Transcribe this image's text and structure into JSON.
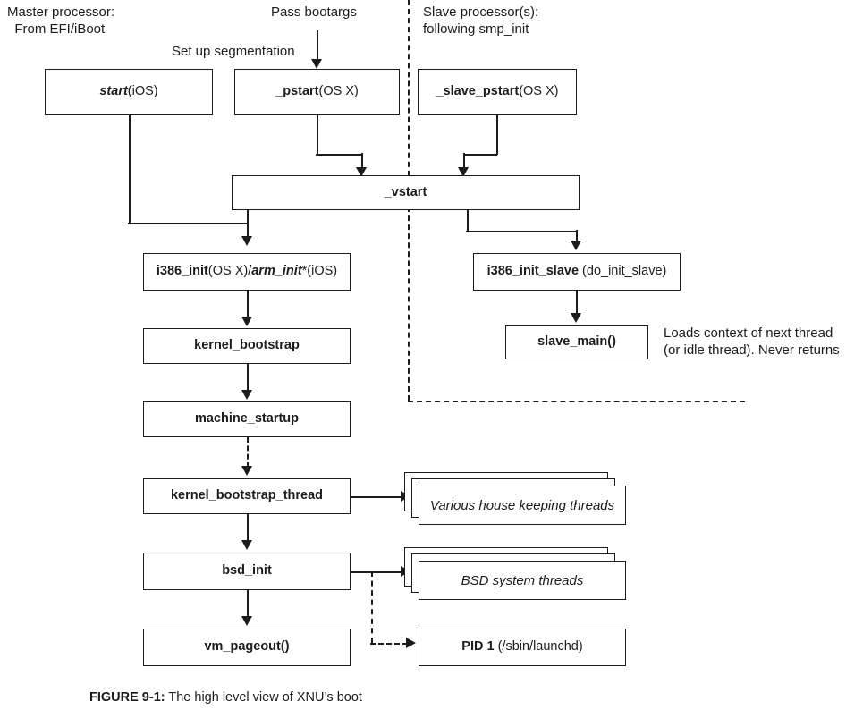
{
  "figure": {
    "caption_number": "FIGURE 9-1:",
    "caption_text": "The high level view of XNU’s boot"
  },
  "annotations": {
    "master_header": "Master processor:\n  From EFI/iBoot",
    "slave_header": "Slave processor(s):\nfollowing smp_init",
    "pass_bootargs": "Pass bootargs",
    "set_up_segmentation": "Set up segmentation",
    "slave_main_note": "Loads context of next thread\n(or idle thread). Never returns"
  },
  "nodes": {
    "start_ios": {
      "bold": "start",
      "plain": "(iOS)"
    },
    "pstart": {
      "bold": "_pstart",
      "plain": "(OS X)"
    },
    "slave_pstart": {
      "bold": "_slave_pstart",
      "plain": "(OS X)"
    },
    "vstart": {
      "bold": "_vstart",
      "plain": ""
    },
    "i386_init": {
      "bold": "i386_init",
      "plain": "(OS X)/",
      "bold_italic": "arm_init",
      "plain2": "*(iOS)"
    },
    "i386_init_slave": {
      "bold": "i386_init_slave",
      "plain": " (do_init_slave)"
    },
    "slave_main": {
      "bold": "slave_main()",
      "plain": ""
    },
    "kernel_bootstrap": {
      "bold": "kernel_bootstrap",
      "plain": ""
    },
    "machine_startup": {
      "bold": "machine_startup",
      "plain": ""
    },
    "kernel_bootstrap_thread": {
      "bold": "kernel_bootstrap_thread",
      "plain": ""
    },
    "bsd_init": {
      "bold": "bsd_init",
      "plain": ""
    },
    "vm_pageout": {
      "bold": "vm_pageout()",
      "plain": ""
    },
    "housekeeping_threads": {
      "text": "Various house keeping threads"
    },
    "bsd_system_threads": {
      "text": "BSD system threads"
    },
    "pid1": {
      "bold": "PID 1",
      "plain": " (/sbin/launchd)"
    }
  },
  "colors": {
    "ink": "#1b1b20",
    "paper": "#ffffff"
  }
}
